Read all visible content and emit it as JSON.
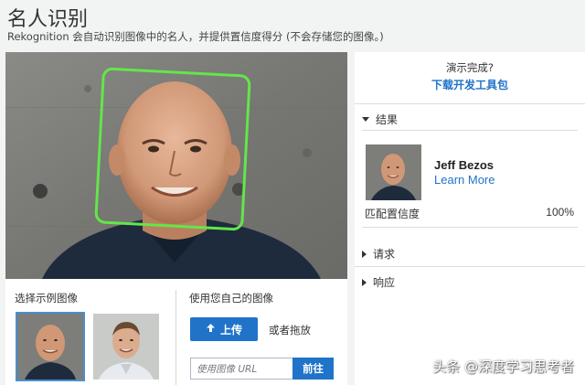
{
  "header": {
    "title": "名人识别",
    "description": "Rekognition 会自动识别图像中的名人，并提供置信度得分 (不会存储您的图像。)"
  },
  "demo_panel": {
    "done_text": "演示完成?",
    "sdk_link": "下载开发工具包"
  },
  "results_section": {
    "label": "结果",
    "celebrity_name": "Jeff Bezos",
    "learn_more": "Learn More",
    "confidence_label": "匹配置信度",
    "confidence_value": "100%"
  },
  "request_section": {
    "label": "请求"
  },
  "response_section": {
    "label": "响应"
  },
  "samples": {
    "label": "选择示例图像",
    "selected_index": 0
  },
  "own_image": {
    "label": "使用您自己的图像",
    "upload_label": "上传",
    "drag_text": "或者拖放",
    "url_placeholder": "使用图像 URL",
    "go_label": "前往"
  },
  "watermark": "头条 @深度学习思考者",
  "colors": {
    "accent": "#1f73c9",
    "face_box": "#63e64a",
    "background": "#f2f3f3"
  }
}
